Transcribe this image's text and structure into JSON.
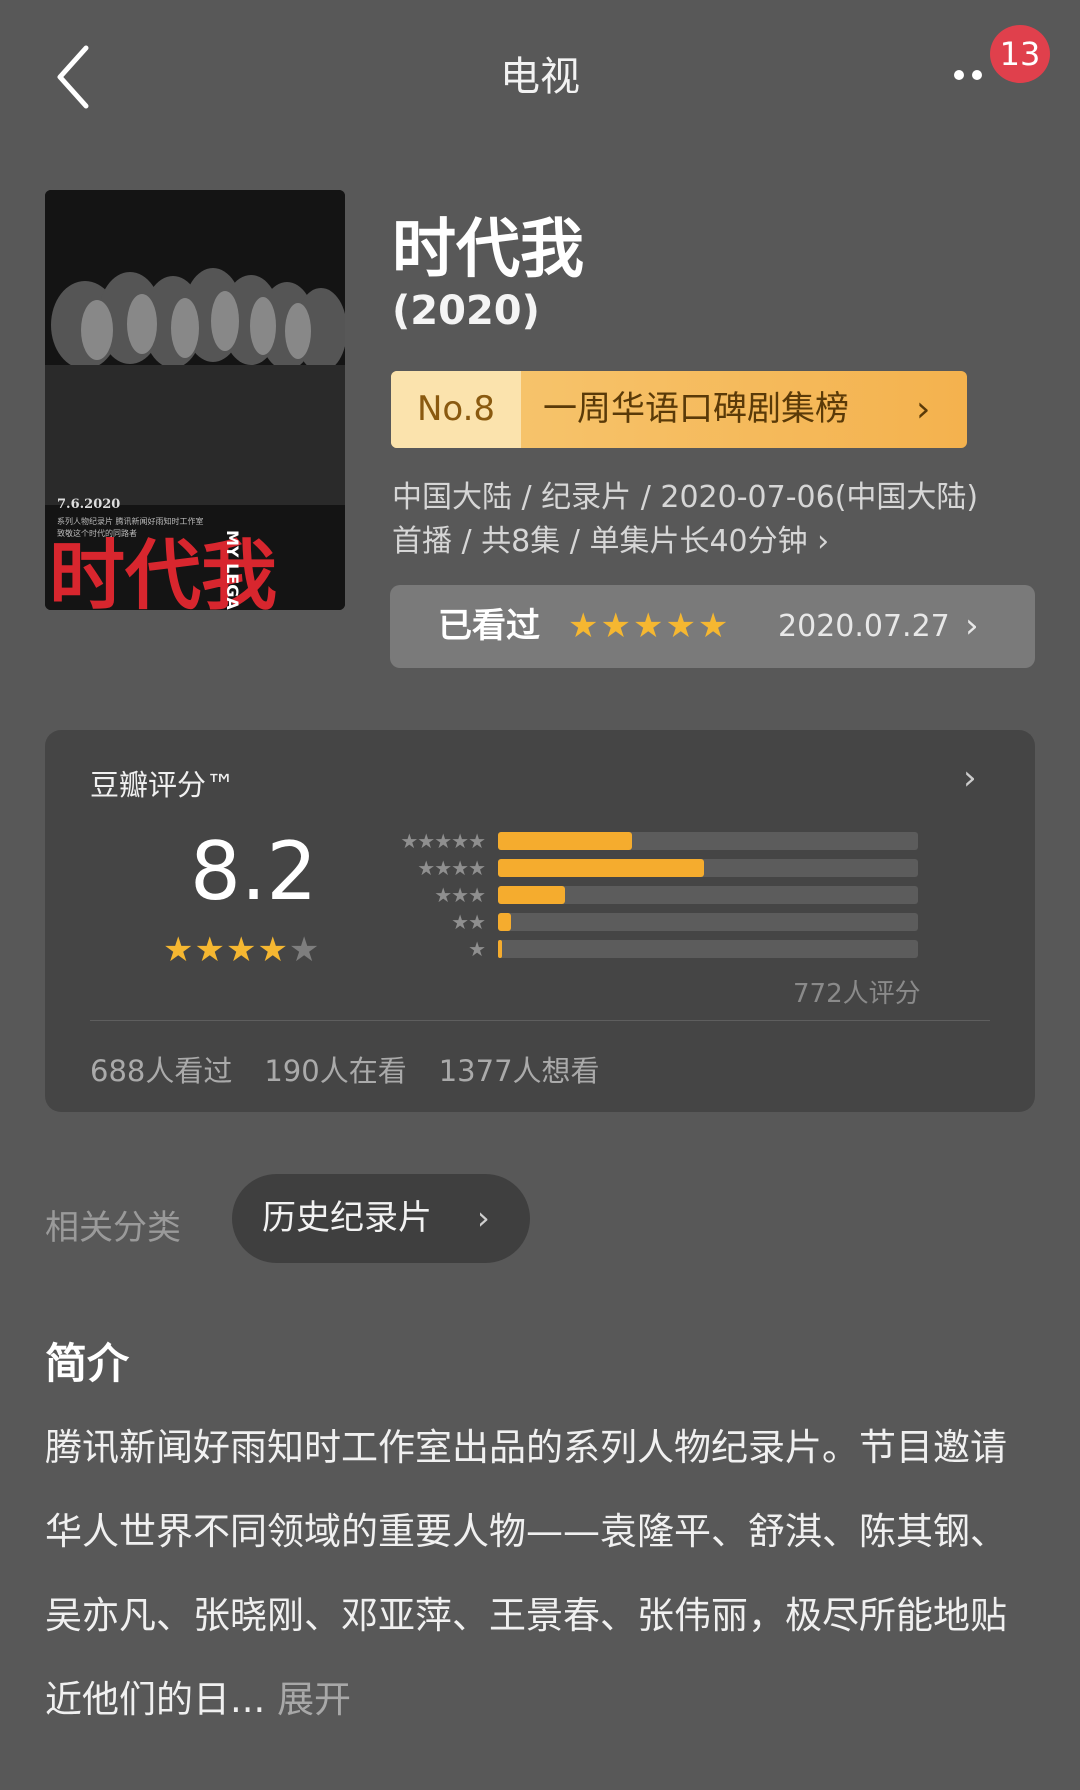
{
  "header": {
    "title": "电视",
    "notification_count": "13"
  },
  "poster": {
    "line_top": "7.6.2020",
    "line_mid": "系列人物纪录片 腾讯新闻好雨知时工作室",
    "line_low": "致敬这个时代的同路者",
    "title_cn": "时代我",
    "title_en": "MY LEGA"
  },
  "movie": {
    "title": "时代我",
    "year": "(2020)",
    "rank_no": "No.8",
    "rank_label": "一周华语口碑剧集榜",
    "meta_line1": "中国大陆 / 纪录片 / 2020-07-06(中国大陆)",
    "meta_line2": "首播 / 共8集 / 单集片长40分钟 ›"
  },
  "watched": {
    "label": "已看过",
    "stars": "★★★★★",
    "date": "2020.07.27"
  },
  "rating": {
    "title": "豆瓣评分™",
    "score": "8.2",
    "stars_filled": "★★★★",
    "stars_empty": "★",
    "count": "772人评分",
    "distribution": [
      {
        "stars": "★★★★★",
        "fraction": 0.32
      },
      {
        "stars": "★★★★",
        "fraction": 0.49
      },
      {
        "stars": "★★★",
        "fraction": 0.16
      },
      {
        "stars": "★★",
        "fraction": 0.03
      },
      {
        "stars": "★",
        "fraction": 0.01
      }
    ],
    "watched_count": "688人看过",
    "watching_count": "190人在看",
    "want_count": "1377人想看"
  },
  "related": {
    "label": "相关分类",
    "tag": "历史纪录片"
  },
  "intro": {
    "heading": "简介",
    "text": "腾讯新闻好雨知时工作室出品的系列人物纪录片。节目邀请华人世界不同领域的重要人物——袁隆平、舒淇、陈其钢、吴亦凡、张晓刚、邓亚萍、王景春、张伟丽，极尽所能地贴近他们的日...",
    "expand": "展开"
  }
}
